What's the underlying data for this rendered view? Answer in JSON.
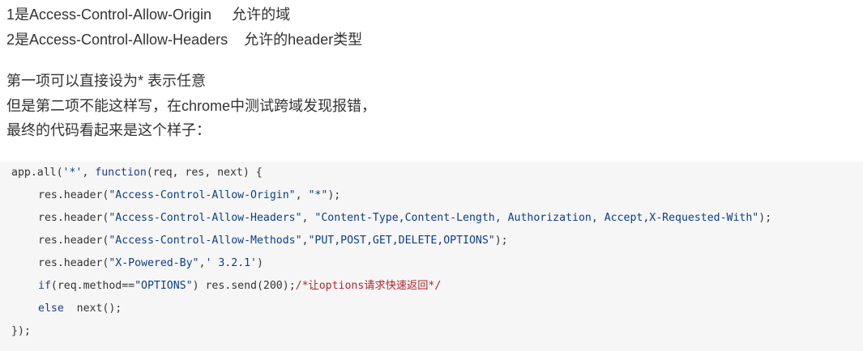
{
  "prose": {
    "line1": "1是Access-Control-Allow-Origin     允许的域",
    "line2": "2是Access-Control-Allow-Headers    允许的header类型",
    "line3": "第一项可以直接设为* 表示任意",
    "line4": "但是第二项不能这样写，在chrome中测试跨域发现报错，",
    "line5": "最终的代码看起来是这个样子："
  },
  "code": {
    "line1": {
      "a": "app.all(",
      "s1": "'*'",
      "b": ", ",
      "kw": "function",
      "c": "(req, res, next) {"
    },
    "line2": {
      "a": "res.header(",
      "s1": "\"Access-Control-Allow-Origin\"",
      "b": ", ",
      "s2": "\"*\"",
      "c": ");"
    },
    "line3": {
      "a": "res.header(",
      "s1": "\"Access-Control-Allow-Headers\"",
      "b": ", ",
      "s2": "\"Content-Type,Content-Length, Authorization, Accept,X-Requested-With\"",
      "c": ");"
    },
    "line4": {
      "a": "res.header(",
      "s1": "\"Access-Control-Allow-Methods\"",
      "b": ",",
      "s2": "\"PUT,POST,GET,DELETE,OPTIONS\"",
      "c": ");"
    },
    "line5": {
      "a": "res.header(",
      "s1": "\"X-Powered-By\"",
      "b": ",",
      "s2": "' 3.2.1'",
      "c": ")"
    },
    "line6": {
      "kw": "if",
      "a": "(req.method==",
      "s1": "\"OPTIONS\"",
      "b": ") res.send(",
      "num": "200",
      "c": ");",
      "cmt": "/*让options请求快速返回*/"
    },
    "line7": {
      "kw": "else",
      "a": "  next();"
    },
    "line8": {
      "a": "});"
    }
  }
}
